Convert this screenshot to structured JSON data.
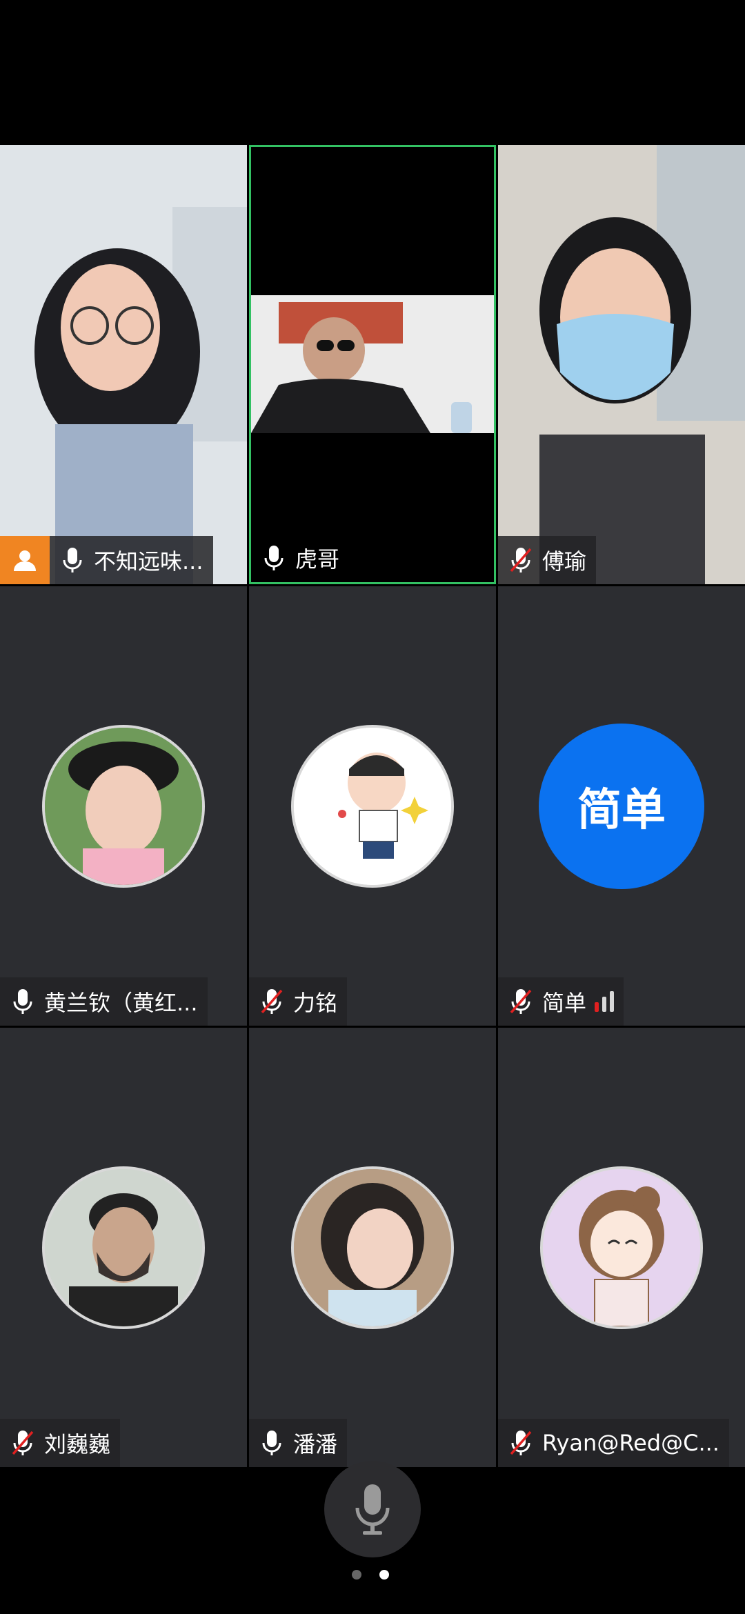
{
  "participants": [
    {
      "name": "不知远味...",
      "mic": "on",
      "host": true
    },
    {
      "name": "虎哥",
      "mic": "on"
    },
    {
      "name": "傅瑜",
      "mic": "muted"
    },
    {
      "name": "黄兰钦（黄红...",
      "mic": "on"
    },
    {
      "name": "力铭",
      "mic": "muted"
    },
    {
      "name": "简单",
      "mic": "muted",
      "avatar_text": "简单",
      "signal": true
    },
    {
      "name": "刘巍巍",
      "mic": "muted"
    },
    {
      "name": "潘潘",
      "mic": "on"
    },
    {
      "name": "Ryan@Red@C...",
      "mic": "muted"
    }
  ],
  "controls": {
    "mic_button_icon": "microphone-icon"
  },
  "pagination": {
    "pages": 2,
    "current": 2
  },
  "colors": {
    "active_border": "#33c163",
    "host_badge": "#f08522",
    "avatar_blue": "#0b72f0",
    "tile_bg": "#2c2d31",
    "mute_red": "#e02020"
  }
}
